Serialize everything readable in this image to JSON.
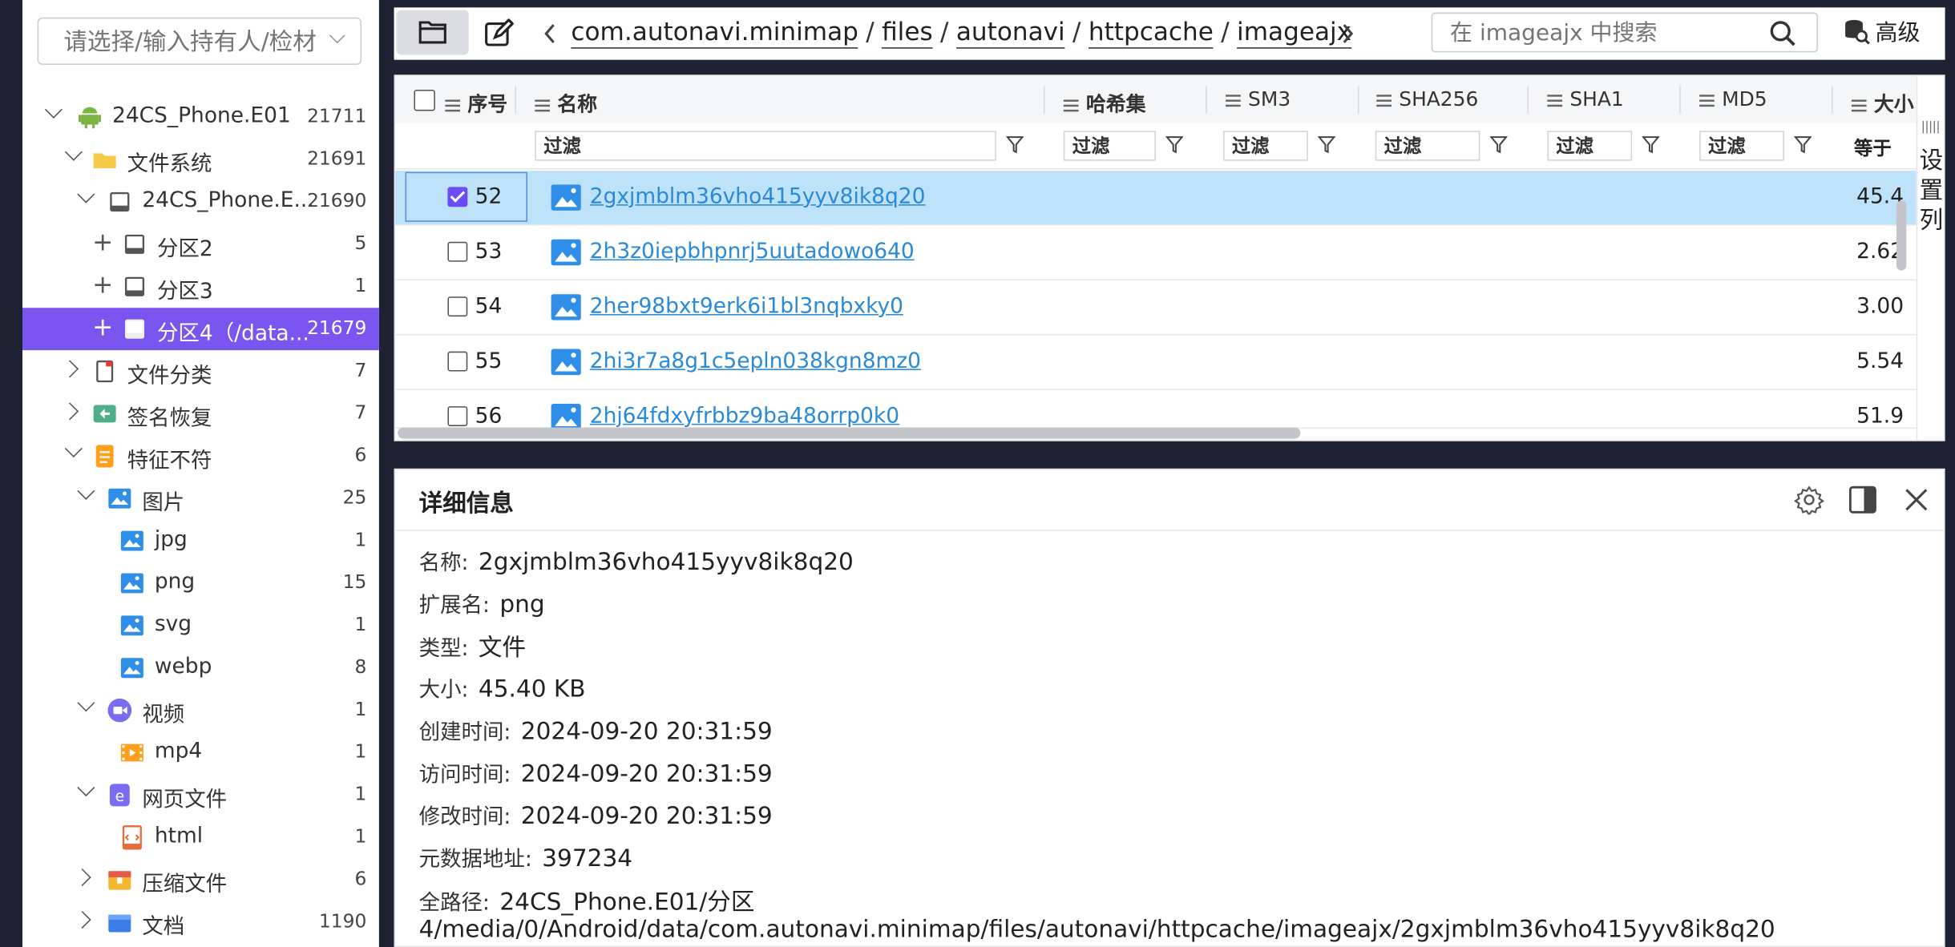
{
  "owner_select": {
    "placeholder": "请选择/输入持有人/检材"
  },
  "tree": [
    {
      "label": "24CS_Phone.E01",
      "count": "21711",
      "icon": "android-icon"
    },
    {
      "label": "文件系统",
      "count": "21691",
      "icon": "folder-icon"
    },
    {
      "label": "24CS_Phone.E...",
      "count": "21690",
      "icon": "disk-icon"
    },
    {
      "label": "分区2",
      "count": "5",
      "icon": "disk-icon"
    },
    {
      "label": "分区3",
      "count": "1",
      "icon": "disk-icon"
    },
    {
      "label": "分区4（/data...",
      "count": "21679",
      "icon": "disk-icon"
    },
    {
      "label": "文件分类",
      "count": "7",
      "icon": "file-category-icon"
    },
    {
      "label": "签名恢复",
      "count": "7",
      "icon": "signature-recovery-icon"
    },
    {
      "label": "特征不符",
      "count": "6",
      "icon": "mismatch-icon"
    },
    {
      "label": "图片",
      "count": "25",
      "icon": "image-icon"
    },
    {
      "label": "jpg",
      "count": "1",
      "icon": "image-icon"
    },
    {
      "label": "png",
      "count": "15",
      "icon": "image-icon"
    },
    {
      "label": "svg",
      "count": "1",
      "icon": "image-icon"
    },
    {
      "label": "webp",
      "count": "8",
      "icon": "image-icon"
    },
    {
      "label": "视频",
      "count": "1",
      "icon": "video-icon"
    },
    {
      "label": "mp4",
      "count": "1",
      "icon": "film-icon"
    },
    {
      "label": "网页文件",
      "count": "1",
      "icon": "webpage-icon"
    },
    {
      "label": "html",
      "count": "1",
      "icon": "html-file-icon"
    },
    {
      "label": "压缩文件",
      "count": "6",
      "icon": "archive-icon"
    },
    {
      "label": "文档",
      "count": "1190",
      "icon": "document-icon"
    }
  ],
  "breadcrumb": {
    "items": [
      "com.autonavi.minimap",
      "files",
      "autonavi",
      "httpcache",
      "imageajx"
    ],
    "separator": "/"
  },
  "search": {
    "placeholder": "在 imageajx 中搜索"
  },
  "advanced_label": "高级",
  "grid": {
    "headers": {
      "index": "序号",
      "name": "名称",
      "hash_set": "哈希集",
      "sm3": "SM3",
      "sha256": "SHA256",
      "sha1": "SHA1",
      "md5": "MD5",
      "size": "大小"
    },
    "filter_placeholder": "过滤",
    "size_filter": "等于",
    "rows": [
      {
        "index": "52",
        "name": "2gxjmblm36vho415yyv8ik8q20",
        "size": "45.4",
        "selected": true
      },
      {
        "index": "53",
        "name": "2h3z0iepbhpnrj5uutadowo640",
        "size": "2.62",
        "selected": false
      },
      {
        "index": "54",
        "name": "2her98bxt9erk6i1bl3nqbxky0",
        "size": "3.00",
        "selected": false
      },
      {
        "index": "55",
        "name": "2hi3r7a8g1c5epln038kgn8mz0",
        "size": "5.54",
        "selected": false
      },
      {
        "index": "56",
        "name": "2hj64fdxyfrbbz9ba48orrp0k0",
        "size": "51.9",
        "selected": false
      }
    ],
    "column_settings": "设置列"
  },
  "detail": {
    "title": "详细信息",
    "name_label": "名称:",
    "name": "2gxjmblm36vho415yyv8ik8q20",
    "ext_label": "扩展名:",
    "ext": "png",
    "type_label": "类型:",
    "type": "文件",
    "size_label": "大小:",
    "size": "45.40 KB",
    "created_label": "创建时间:",
    "created": "2024-09-20 20:31:59",
    "accessed_label": "访问时间:",
    "accessed": "2024-09-20 20:31:59",
    "modified_label": "修改时间:",
    "modified": "2024-09-20 20:31:59",
    "meta_label": "元数据地址:",
    "meta": "397234",
    "path_label": "全路径:",
    "path_line1": "24CS_Phone.E01/分区",
    "path_line2": "4/media/0/Android/data/com.autonavi.minimap/files/autonavi/httpcache/imageajx/2gxjmblm36vho415yyv8ik8q20"
  },
  "colors": {
    "accent": "#7a56f0",
    "selected_row": "#bfe2fb",
    "link": "#2a8ad8",
    "background": "#1f2233"
  }
}
